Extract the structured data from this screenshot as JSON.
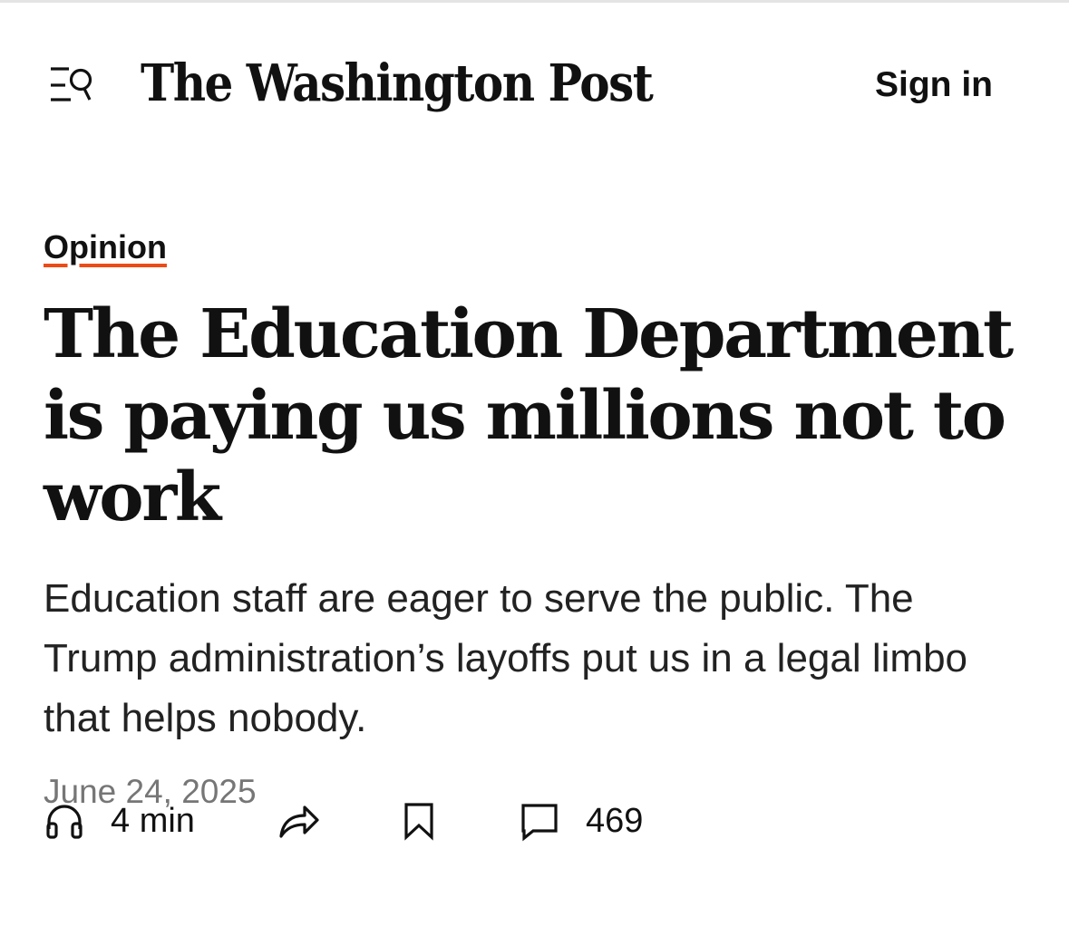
{
  "header": {
    "logo_text": "The Washington Post",
    "sign_in_label": "Sign in",
    "menu_icon": "menu-search-icon"
  },
  "article": {
    "section": "Opinion",
    "headline": "The Education Department is paying us millions not to work",
    "dek": "Education staff are eager to serve the public. The Trump administration’s layoffs put us in a legal limbo that helps nobody.",
    "date": "June 24, 2025"
  },
  "actions": {
    "listen_icon": "headphones-icon",
    "listen_label": "4 min",
    "share_icon": "share-arrow-icon",
    "save_icon": "bookmark-icon",
    "comments_icon": "comment-icon",
    "comments_count": "469"
  },
  "colors": {
    "text": "#111111",
    "accent_underline": "#ec4a17",
    "date_gray": "#767676"
  }
}
